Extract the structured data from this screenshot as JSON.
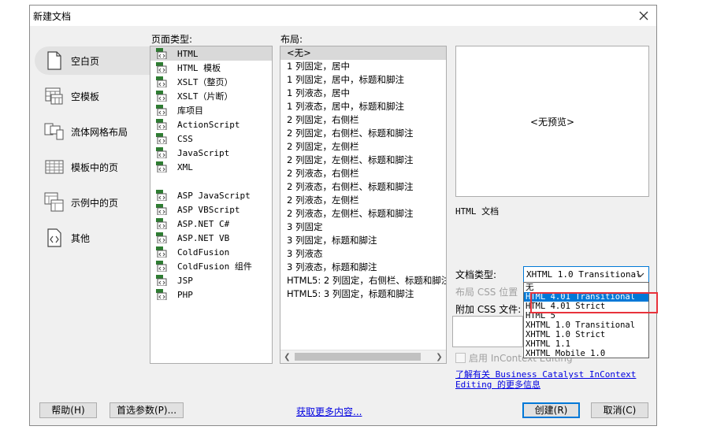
{
  "window": {
    "title": "新建文档"
  },
  "categories": [
    {
      "label": "空白页",
      "icon": "blank-page-icon",
      "selected": true
    },
    {
      "label": "空模板",
      "icon": "blank-template-icon",
      "selected": false
    },
    {
      "label": "流体网格布局",
      "icon": "fluid-grid-icon",
      "selected": false
    },
    {
      "label": "模板中的页",
      "icon": "template-page-icon",
      "selected": false
    },
    {
      "label": "示例中的页",
      "icon": "sample-page-icon",
      "selected": false
    },
    {
      "label": "其他",
      "icon": "code-file-icon",
      "selected": false
    }
  ],
  "page_type": {
    "header": "页面类型:",
    "items": [
      "HTML",
      "HTML 模板",
      "XSLT（整页）",
      "XSLT（片断）",
      "库项目",
      "ActionScript",
      "CSS",
      "JavaScript",
      "XML"
    ],
    "items2": [
      "ASP JavaScript",
      "ASP VBScript",
      "ASP.NET C#",
      "ASP.NET VB",
      "ColdFusion",
      "ColdFusion 组件",
      "JSP",
      "PHP"
    ],
    "selected": "HTML"
  },
  "layout": {
    "header": "布局:",
    "items": [
      "<无>",
      "1 列固定，居中",
      "1 列固定，居中，标题和脚注",
      "1 列液态，居中",
      "1 列液态，居中，标题和脚注",
      "2 列固定，右侧栏",
      "2 列固定，右侧栏、标题和脚注",
      "2 列固定，左侧栏",
      "2 列固定，左侧栏、标题和脚注",
      "2 列液态，右侧栏",
      "2 列液态，右侧栏、标题和脚注",
      "2 列液态，左侧栏",
      "2 列液态，左侧栏、标题和脚注",
      "3 列固定",
      "3 列固定，标题和脚注",
      "3 列液态",
      "3 列液态，标题和脚注",
      "HTML5: 2 列固定，右侧栏、标题和脚注",
      "HTML5: 3 列固定，标题和脚注"
    ],
    "selected": "<无>"
  },
  "preview": {
    "text": "<无预览>"
  },
  "description": "HTML 文档",
  "doctype": {
    "label": "文档类型:",
    "selected": "XHTML 1.0 Transitional",
    "options": [
      "无",
      "HTML 4.01 Transitional",
      "HTML 4.01 Strict",
      "HTML 5",
      "XHTML 1.0 Transitional",
      "XHTML 1.0 Strict",
      "XHTML 1.1",
      "XHTML Mobile 1.0"
    ],
    "highlighted": "HTML 4.01 Transitional"
  },
  "layout_css": {
    "label": "布局 CSS 位置"
  },
  "attach_css": {
    "label": "附加 CSS 文件:"
  },
  "incontext": {
    "label": "启用 InContext Editing"
  },
  "bc_link": "了解有关 Business Catalyst InContext Editing 的更多信息",
  "more_link": "获取更多内容...",
  "buttons": {
    "help": "帮助(H)",
    "prefs": "首选参数(P)...",
    "create": "创建(R)",
    "cancel": "取消(C)"
  },
  "colors": {
    "accent": "#0078d7",
    "highlight_box": "#e8323b",
    "link": "#0000e0"
  }
}
